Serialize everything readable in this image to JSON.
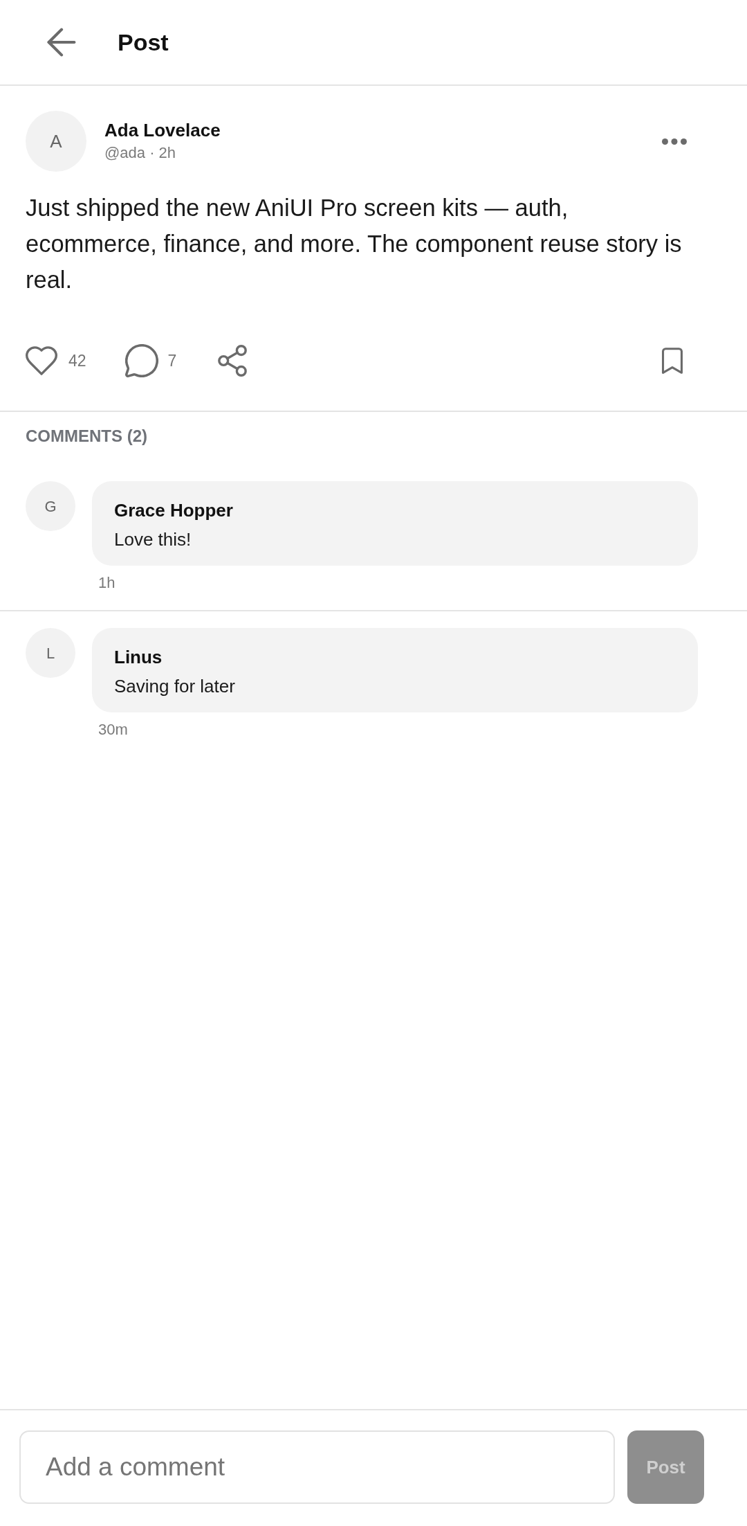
{
  "header": {
    "title": "Post"
  },
  "post": {
    "author": {
      "initial": "A",
      "name": "Ada Lovelace",
      "meta": "@ada · 2h"
    },
    "body": "Just shipped the new AniUI Pro screen kits — auth, ecommerce, finance, and more. The component reuse story is real.",
    "actions": {
      "likes": "42",
      "liked": false,
      "comments": "7",
      "bookmarked": false
    }
  },
  "comments_section": {
    "heading": "COMMENTS (2)",
    "comments": [
      {
        "initial": "G",
        "name": "Grace Hopper",
        "text": "Love this!",
        "time": "1h"
      },
      {
        "initial": "L",
        "name": "Linus",
        "text": "Saving for later",
        "time": "30m"
      }
    ]
  },
  "composer": {
    "placeholder": "Add a comment",
    "button": {
      "label": "Post",
      "disabled": true
    }
  }
}
